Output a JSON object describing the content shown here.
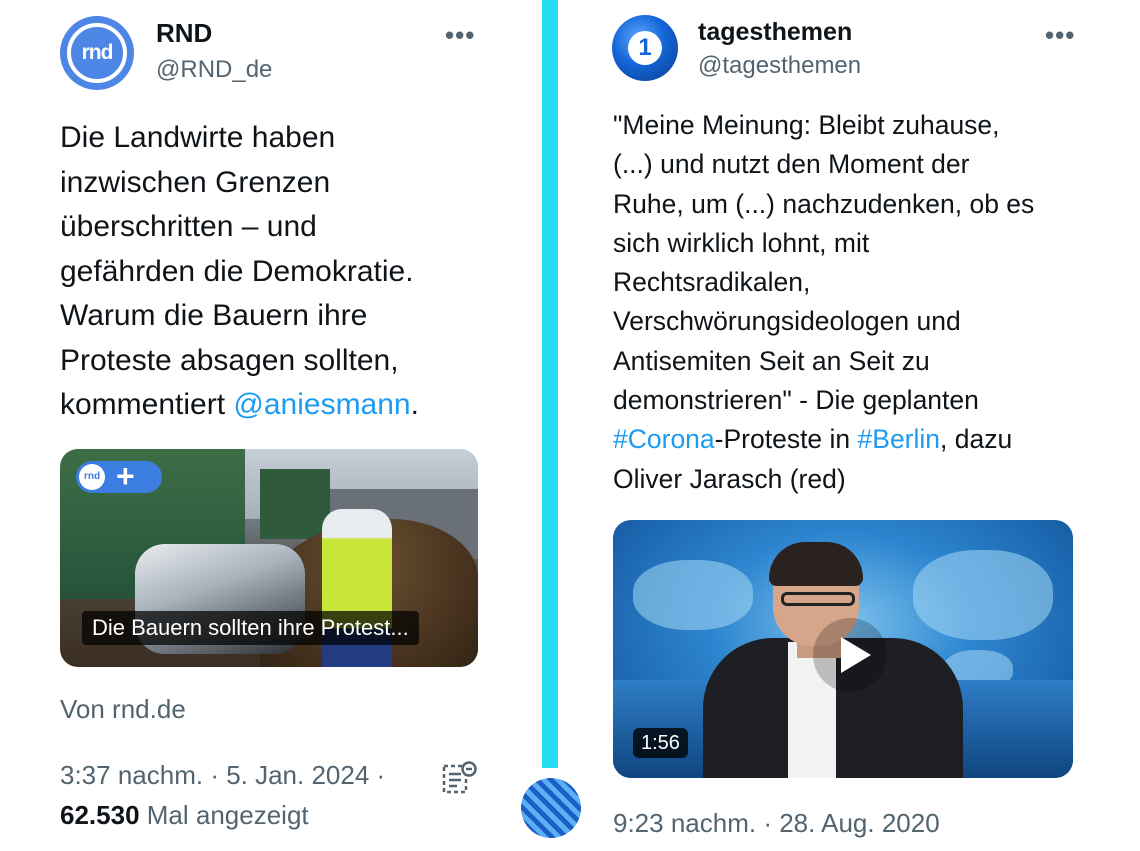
{
  "left_tweet": {
    "name": "RND",
    "handle": "@RND_de",
    "avatar_text": "rnd",
    "more_label": "•••",
    "body_lines": [
      "Die Landwirte haben",
      "inzwischen Grenzen",
      "überschritten – und",
      "gefährden die Demokratie.",
      "Warum die Bauern ihre",
      "Proteste absagen sollten,"
    ],
    "body_last_prefix": "kommentiert ",
    "body_mention": "@aniesmann",
    "body_last_suffix": ".",
    "card": {
      "badge_logo": "rnd",
      "badge_plus": "+",
      "caption": "Die Bauern sollten ihre Protest..."
    },
    "source": "Von rnd.de",
    "timestamp": "3:37 nachm. · 5. Jan. 2024 ·",
    "views_count": "62.530",
    "views_label": "Mal angezeigt"
  },
  "right_tweet": {
    "name": "tagesthemen",
    "handle": "@tagesthemen",
    "avatar_text": "1",
    "more_label": "•••",
    "body_lines": [
      "\"Meine Meinung: Bleibt zuhause,",
      "(...) und nutzt den Moment der",
      "Ruhe, um (...) nachzudenken, ob es",
      "sich wirklich lohnt, mit",
      "Rechtsradikalen,",
      "Verschwörungsideologen und",
      "Antisemiten Seit an Seit zu",
      "demonstrieren\" - Die geplanten"
    ],
    "hashtag_1": "#Corona",
    "between_hashtags": "-Proteste in ",
    "hashtag_2": "#Berlin",
    "after_hashtags": ", dazu",
    "final_line": "Oliver Jarasch (red)",
    "video": {
      "duration": "1:56"
    },
    "timestamp": "9:23 nachm. · 28. Aug. 2020"
  },
  "colors": {
    "link": "#1d9bf0",
    "divider": "#27dcf0",
    "rnd_brand": "#4e86e6",
    "secondary_text": "#536471"
  }
}
